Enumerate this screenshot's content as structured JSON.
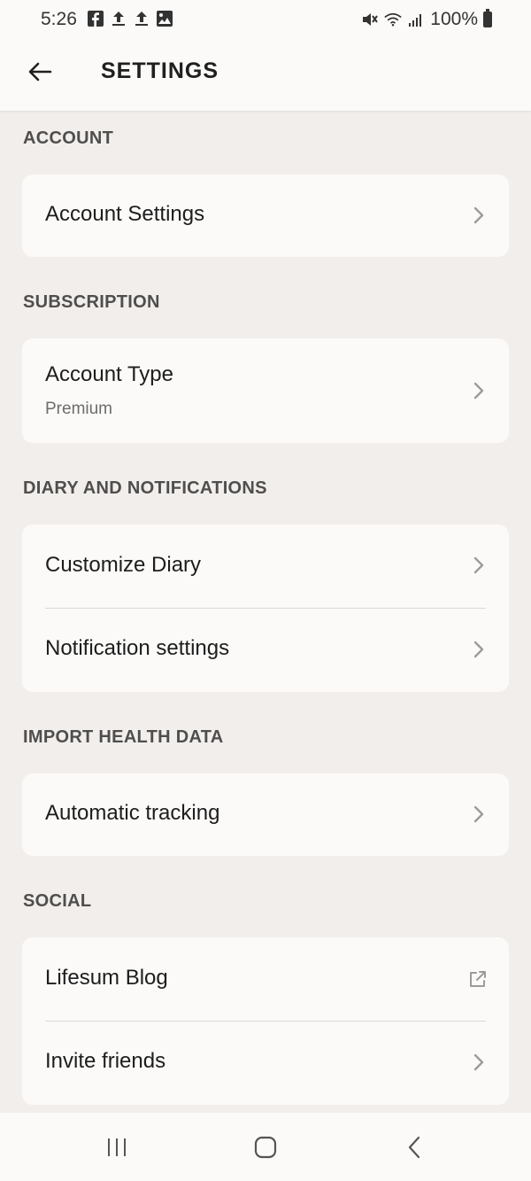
{
  "status_bar": {
    "time": "5:26",
    "battery": "100%",
    "left_icons": [
      "facebook-icon",
      "upload-icon",
      "upload-icon",
      "image-icon"
    ],
    "right_icons": [
      "mute-icon",
      "wifi-icon",
      "signal-icon",
      "battery-icon"
    ]
  },
  "app_bar": {
    "title": "SETTINGS",
    "back_icon": "arrow-left-icon"
  },
  "sections": {
    "account": {
      "header": "ACCOUNT",
      "items": [
        {
          "title": "Account Settings"
        }
      ]
    },
    "subscription": {
      "header": "SUBSCRIPTION",
      "items": [
        {
          "title": "Account Type",
          "subtitle": "Premium"
        }
      ]
    },
    "diary": {
      "header": "DIARY AND NOTIFICATIONS",
      "items": [
        {
          "title": "Customize Diary"
        },
        {
          "title": "Notification settings"
        }
      ]
    },
    "health": {
      "header": "IMPORT HEALTH DATA",
      "items": [
        {
          "title": "Automatic tracking"
        }
      ]
    },
    "social": {
      "header": "SOCIAL",
      "items": [
        {
          "title": "Lifesum Blog",
          "icon": "external-link-icon"
        },
        {
          "title": "Invite friends"
        }
      ]
    }
  },
  "colors": {
    "background": "#f2eeeb",
    "card": "#fbfaf8",
    "header_text": "#4e4e4e",
    "chevron": "#9b9b9b"
  },
  "nav_bar": {
    "buttons": [
      "recent-apps-icon",
      "home-icon",
      "back-icon"
    ]
  }
}
